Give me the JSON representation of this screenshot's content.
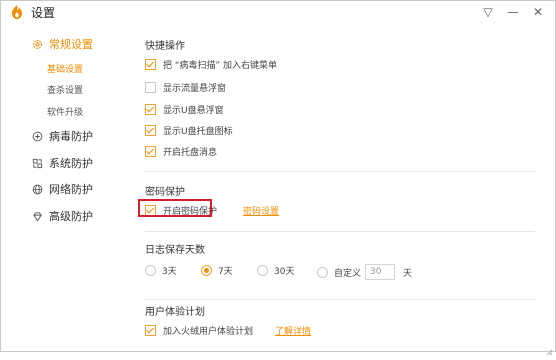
{
  "window": {
    "title": "设置"
  },
  "controls": {
    "menu": "▽",
    "minimize": "—",
    "close": "✕"
  },
  "sidebar": {
    "items": [
      {
        "label": "常规设置",
        "icon": "gear-icon",
        "active": true
      },
      {
        "label": "病毒防护",
        "icon": "shield-plus-icon",
        "active": false
      },
      {
        "label": "系统防护",
        "icon": "system-icon",
        "active": false
      },
      {
        "label": "网络防护",
        "icon": "globe-icon",
        "active": false
      },
      {
        "label": "高级防护",
        "icon": "diamond-icon",
        "active": false
      }
    ],
    "subitems": [
      {
        "label": "基础设置",
        "active": true
      },
      {
        "label": "查杀设置",
        "active": false
      },
      {
        "label": "软件升级",
        "active": false
      }
    ]
  },
  "shortcut": {
    "title": "快捷操作",
    "options": [
      {
        "label": "把 “病毒扫描” 加入右键菜单",
        "checked": true
      },
      {
        "label": "显示流量悬浮窗",
        "checked": false
      },
      {
        "label": "显示U盘悬浮窗",
        "checked": true
      },
      {
        "label": "显示U盘托盘图标",
        "checked": true
      },
      {
        "label": "开启托盘消息",
        "checked": true
      }
    ]
  },
  "password": {
    "title": "密码保护",
    "option": {
      "label": "开启密码保护",
      "checked": true
    },
    "link": "密码设置"
  },
  "log": {
    "title": "日志保存天数",
    "options": [
      {
        "label": "3天",
        "checked": false
      },
      {
        "label": "7天",
        "checked": true
      },
      {
        "label": "30天",
        "checked": false
      },
      {
        "label": "自定义",
        "checked": false
      }
    ],
    "custom_value": "30",
    "unit": "天"
  },
  "ux": {
    "title": "用户体验计划",
    "option": {
      "label": "加入火绒用户体验计划",
      "checked": true
    },
    "link": "了解详情"
  },
  "colors": {
    "accent": "#f08c00",
    "highlight": "#d0202a"
  }
}
